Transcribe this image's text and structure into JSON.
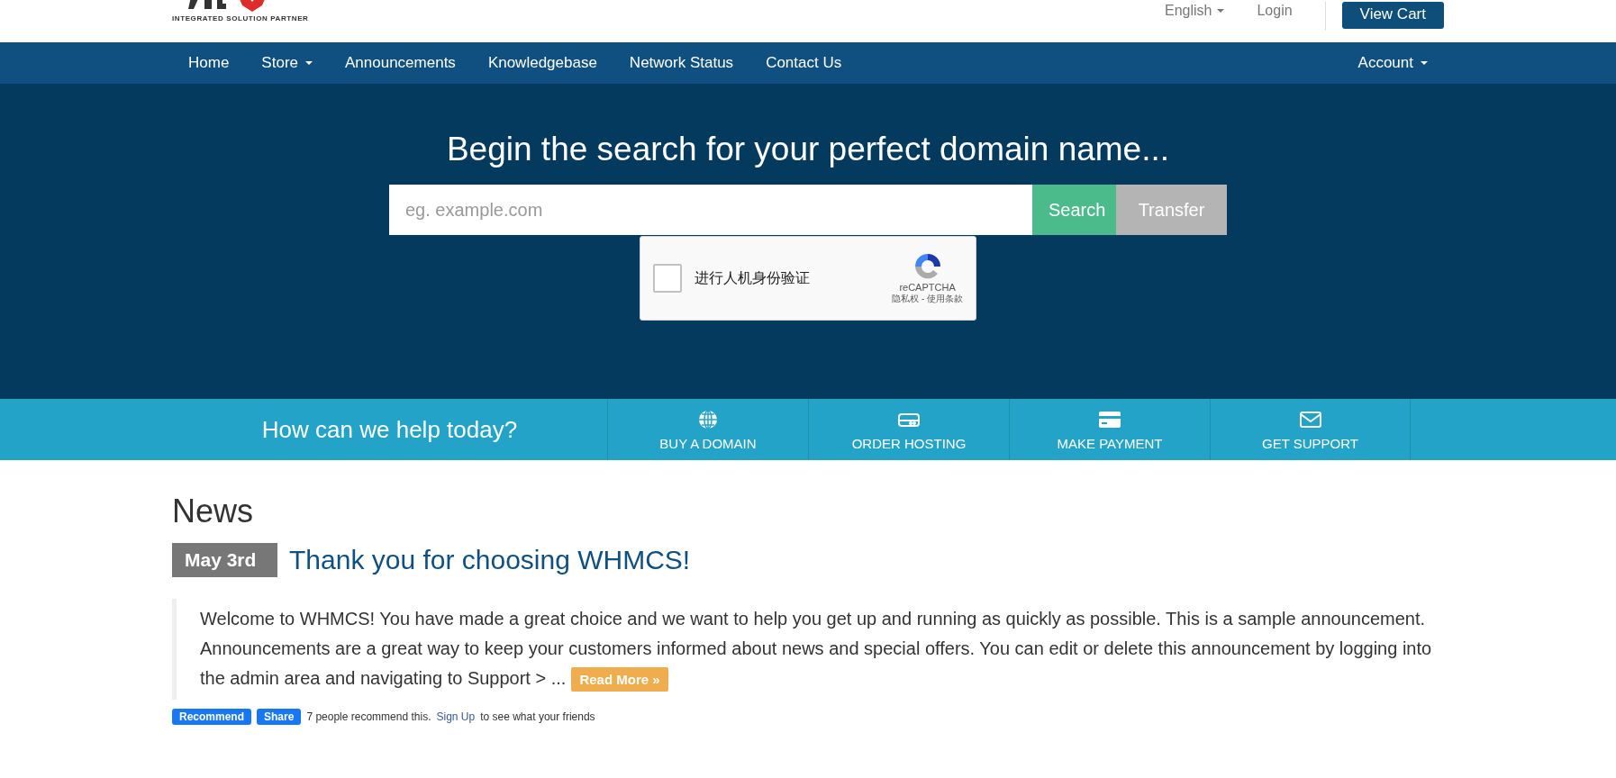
{
  "header": {
    "logo_tagline": "INTEGRATED SOLUTION PARTNER",
    "language": "English",
    "login": "Login",
    "cart_button": "View Cart"
  },
  "nav": {
    "items": [
      {
        "label": "Home",
        "dropdown": false
      },
      {
        "label": "Store",
        "dropdown": true
      },
      {
        "label": "Announcements",
        "dropdown": false
      },
      {
        "label": "Knowledgebase",
        "dropdown": false
      },
      {
        "label": "Network Status",
        "dropdown": false
      },
      {
        "label": "Contact Us",
        "dropdown": false
      }
    ],
    "account": {
      "label": "Account",
      "dropdown": true
    }
  },
  "hero": {
    "title": "Begin the search for your perfect domain name...",
    "search": {
      "placeholder": "eg. example.com"
    },
    "search_button": "Search",
    "transfer_button": "Transfer",
    "captcha": {
      "checked": false,
      "label": "进行人机身份验证",
      "brand": "reCAPTCHA",
      "links": "隐私权 - 使用条款"
    }
  },
  "help_bar": {
    "title": "How can we help today?",
    "actions": [
      {
        "kind": "globe",
        "label": "BUY A DOMAIN"
      },
      {
        "kind": "server",
        "label": "ORDER HOSTING"
      },
      {
        "kind": "card",
        "label": "MAKE PAYMENT"
      },
      {
        "kind": "mail",
        "label": "GET SUPPORT"
      }
    ]
  },
  "news": {
    "heading": "News",
    "items": [
      {
        "date": "May 3rd",
        "title": "Thank you for choosing WHMCS!",
        "body": "Welcome to WHMCS! You have made a great choice and we want to help you get up and running as quickly as possible. This is a sample announcement. Announcements are a great way to keep your customers informed about news and special offers. You can edit or delete this announcement by logging into the admin area and navigating to Support > ...",
        "read_more": "Read More »"
      }
    ]
  },
  "social": {
    "recommend": "Recommend",
    "share": "Share",
    "count_text": "7 people recommend this.",
    "signup": "Sign Up",
    "signup_suffix": "to see what your friends"
  }
}
